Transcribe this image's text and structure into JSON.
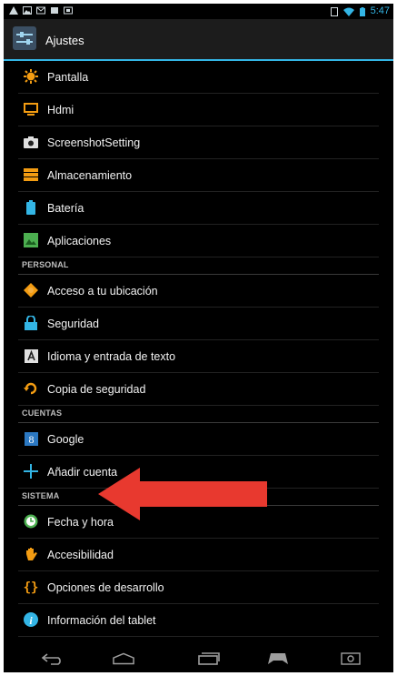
{
  "statusbar": {
    "time": "5:47"
  },
  "actionbar": {
    "title": "Ajustes"
  },
  "sections": [
    {
      "header": "",
      "items": [
        {
          "label": "Pantalla",
          "icon": "brightness-icon"
        },
        {
          "label": "Hdmi",
          "icon": "monitor-icon"
        },
        {
          "label": "ScreenshotSetting",
          "icon": "camera-icon"
        },
        {
          "label": "Almacenamiento",
          "icon": "storage-icon"
        },
        {
          "label": "Batería",
          "icon": "battery-icon"
        },
        {
          "label": "Aplicaciones",
          "icon": "apps-icon"
        }
      ]
    },
    {
      "header": "PERSONAL",
      "items": [
        {
          "label": "Acceso a tu ubicación",
          "icon": "location-icon"
        },
        {
          "label": "Seguridad",
          "icon": "lock-icon"
        },
        {
          "label": "Idioma y entrada de texto",
          "icon": "language-icon"
        },
        {
          "label": "Copia de seguridad",
          "icon": "backup-icon"
        }
      ]
    },
    {
      "header": "CUENTAS",
      "items": [
        {
          "label": "Google",
          "icon": "google-icon"
        },
        {
          "label": "Añadir cuenta",
          "icon": "plus-icon"
        }
      ]
    },
    {
      "header": "SISTEMA",
      "items": [
        {
          "label": "Fecha y hora",
          "icon": "clock-icon"
        },
        {
          "label": "Accesibilidad",
          "icon": "hand-icon"
        },
        {
          "label": "Opciones de desarrollo",
          "icon": "braces-icon"
        },
        {
          "label": "Información del tablet",
          "icon": "info-icon"
        }
      ]
    }
  ],
  "colors": {
    "accent": "#33b5e5",
    "arrow": "#e8392f"
  }
}
